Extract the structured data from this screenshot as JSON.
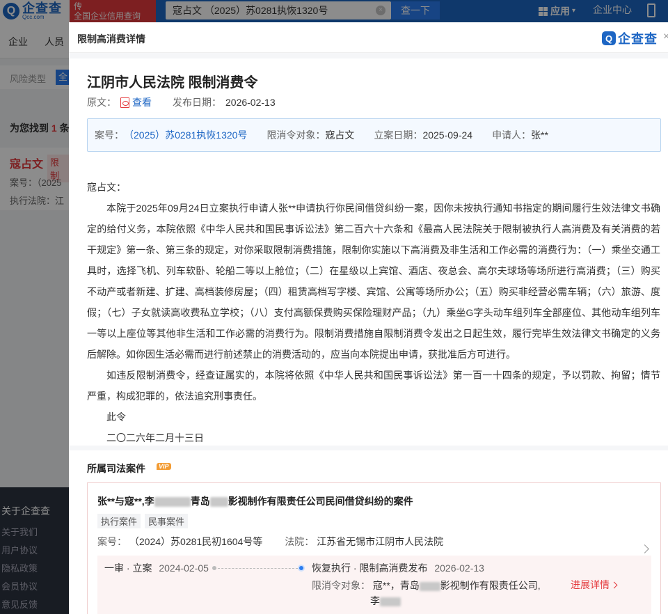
{
  "header": {
    "logo_text": "企查查",
    "logo_sub": "Qcc.com",
    "promo_line1": "传",
    "promo_line2": "全国企业信用查询",
    "search_value": "寇占文 （2025）苏0281执恢1320号",
    "search_button": "查一下",
    "apps_label": "应用",
    "enterprise_label": "企业中心"
  },
  "background": {
    "nav": [
      "企业",
      "人员"
    ],
    "filter_label": "风险类型",
    "filter_chip": "全",
    "found_prefix": "为您找到",
    "found_count": "1",
    "found_suffix": "条",
    "card_name": "寇占文",
    "card_tag": "限制",
    "card_line1": "案号：（2025",
    "card_line2": "执行法院：江",
    "footer_title": "关于企查查",
    "footer_links": [
      "关于我们",
      "用户协议",
      "隐私政策",
      "会员协议",
      "意见反馈"
    ]
  },
  "modal": {
    "title": "限制高消费详情",
    "logo": "企查查",
    "doc_title": "江阴市人民法院 限制消费令",
    "original_label": "原文：",
    "view_label": "查看",
    "publish_label": "发布日期：",
    "publish_date": "2026-02-13",
    "info": {
      "case_no_label": "案号：",
      "case_no": "（2025）苏0281执恢1320号",
      "target_label": "限消令对象：",
      "target": "寇占文",
      "filed_label": "立案日期：",
      "filed_date": "2025-09-24",
      "applicant_label": "申请人：",
      "applicant": "张**"
    },
    "body": {
      "salutation": "寇占文：",
      "para1": "本院于2025年09月24日立案执行申请人张**申请执行你民间借贷纠纷一案，因你未按执行通知书指定的期间履行生效法律文书确定的给付义务，本院依照《中华人民共和国民事诉讼法》第二百六十六条和《最高人民法院关于限制被执行人高消费及有关消费的若干规定》第一条、第三条的规定，对你采取限制消费措施，限制你实施以下高消费及非生活和工作必需的消费行为：（一）乘坐交通工具时，选择飞机、列车软卧、轮船二等以上舱位；（二）在星级以上宾馆、酒店、夜总会、高尔夫球场等场所进行高消费；（三）购买不动产或者新建、扩建、高档装修房屋；（四）租赁高档写字楼、宾馆、公寓等场所办公；（五）购买非经营必需车辆；（六）旅游、度假；（七）子女就读高收费私立学校；（八）支付高额保费购买保险理财产品；（九）乘坐G字头动车组列车全部座位、其他动车组列车一等以上座位等其他非生活和工作必需的消费行为。限制消费措施自限制消费令发出之日起生效，履行完毕生效法律文书确定的义务后解除。如你因生活必需而进行前述禁止的消费活动的，应当向本院提出申请，获批准后方可进行。",
      "para2": "如违反限制消费令，经查证属实的，本院将依照《中华人民共和国民事诉讼法》第一百一十四条的规定，予以罚款、拘留；情节严重，构成犯罪的，依法追究刑事责任。",
      "closing": "此令",
      "date": "二〇二六年二月十三日"
    },
    "related": {
      "title": "所属司法案件",
      "vip": "VIP",
      "case_title_a": "张**与寇**,李",
      "case_title_b": "青岛",
      "case_title_c": "影视制作有限责任公司民间借贷纠纷的案件",
      "tags": [
        "执行案件",
        "民事案件"
      ],
      "case_no_label": "案号：",
      "case_no": "（2024）苏0281民初1604号等",
      "court_label": "法院：",
      "court": "江苏省无锡市江阴市人民法院",
      "stage1": "一审 · 立案",
      "stage1_date": "2024-02-05",
      "stage2": "恢复执行 · 限制高消费发布",
      "stage2_date": "2026-02-13",
      "target_label": "限消令对象：",
      "target_a": "寇**，青岛",
      "target_b": "影视制作有限责任公司,",
      "target_c": "李",
      "more": "进展详情"
    }
  }
}
